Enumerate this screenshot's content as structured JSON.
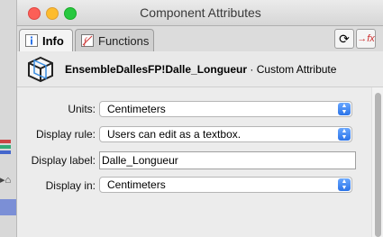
{
  "window": {
    "title": "Component Attributes"
  },
  "tabs": [
    {
      "label": "Info",
      "icon": "info-icon",
      "active": true
    },
    {
      "label": "Functions",
      "icon": "functions-icon",
      "active": false
    }
  ],
  "toolbar": {
    "refresh_icon": "refresh-icon",
    "fx_icon": "fx-icon",
    "fx_symbol": "→fx"
  },
  "header": {
    "component_name": "EnsembleDallesFP!Dalle_Longueur",
    "suffix": " · Custom Attribute"
  },
  "fields": {
    "units": {
      "label": "Units:",
      "value": "Centimeters"
    },
    "display_rule": {
      "label": "Display rule:",
      "value": "Users can edit as a textbox."
    },
    "display_label": {
      "label": "Display label:",
      "value": "Dalle_Longueur"
    },
    "display_in": {
      "label": "Display in:",
      "value": "Centimeters"
    }
  },
  "colors": {
    "accent_blue": "#2b73e8",
    "fx_red": "#cc3333"
  }
}
